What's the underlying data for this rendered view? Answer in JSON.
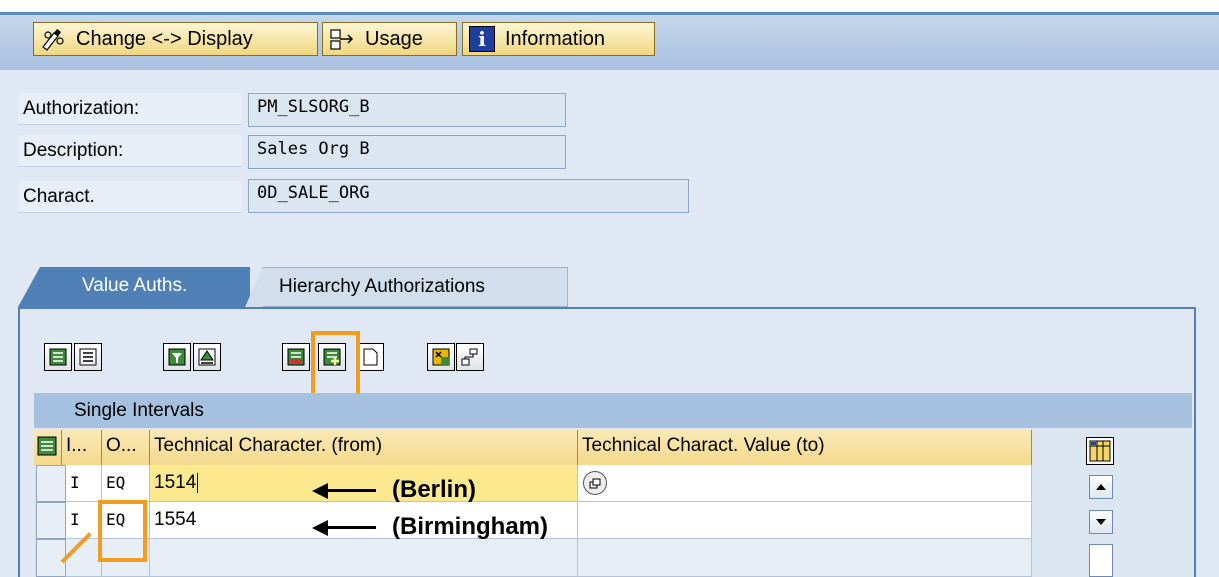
{
  "toolbar": {
    "change_display_label": "Change <-> Display",
    "usage_label": "Usage",
    "information_label": "Information"
  },
  "form": {
    "authorization": {
      "label": "Authorization:",
      "value": "PM_SLSORG_B"
    },
    "description": {
      "label": "Description:",
      "value": "Sales Org B"
    },
    "charact": {
      "label": "Charact.",
      "value": "0D_SALE_ORG"
    }
  },
  "tabs": [
    {
      "label": "Value Auths.",
      "active": true
    },
    {
      "label": "Hierarchy Authorizations",
      "active": false
    }
  ],
  "grid": {
    "title": "Single Intervals",
    "columns": [
      "I...",
      "O...",
      "Technical Character. (from)",
      "Technical Charact. Value (to)"
    ],
    "rows": [
      {
        "i": "I",
        "o": "EQ",
        "from": "1514",
        "to": ""
      },
      {
        "i": "I",
        "o": "EQ",
        "from": "1554",
        "to": ""
      }
    ]
  },
  "annotations": [
    "(Berlin)",
    "(Birmingham)"
  ],
  "colors": {
    "toolbar_bg": "#a9c1df",
    "highlight": "#f39c1d",
    "active_tab": "#4f81b6",
    "header_cell": "#f3d98c",
    "selected_cell": "#fce98f"
  }
}
